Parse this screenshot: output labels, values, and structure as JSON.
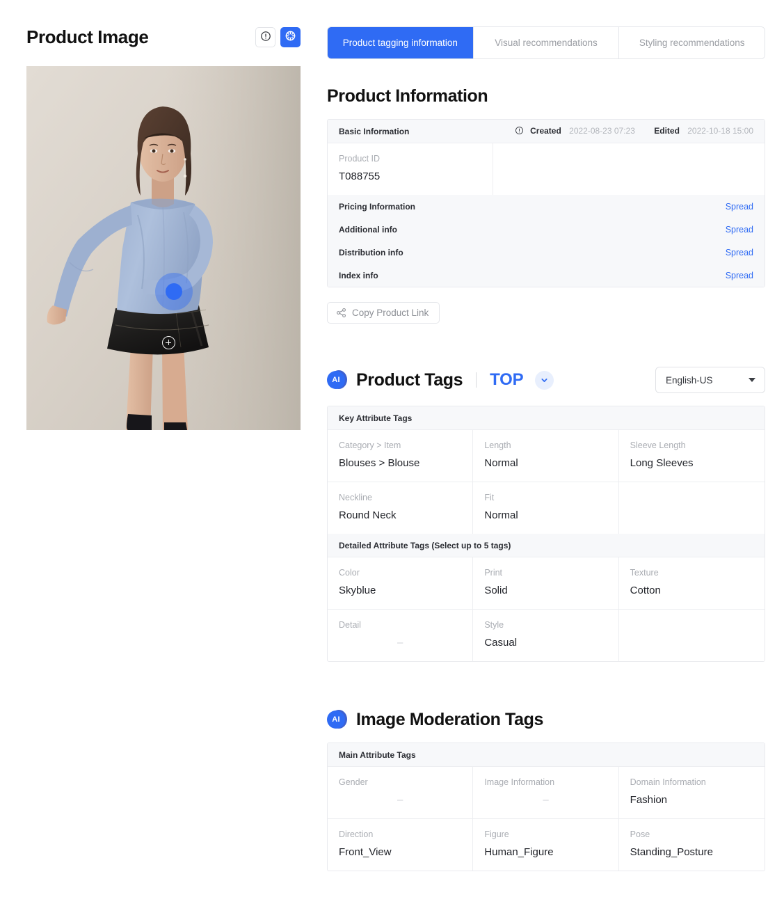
{
  "left": {
    "title": "Product Image",
    "actions": [
      {
        "name": "alert-info-button",
        "icon": "exclamation-circle-icon"
      },
      {
        "name": "tag-point-button",
        "icon": "crosshair-circle-icon"
      }
    ],
    "image_alt": "Female model wearing a sky blue blouse and black leather skirt",
    "hotspot_label": "tag-hotspot",
    "add_point_label": "add-tag-point"
  },
  "tabs": [
    {
      "label": "Product tagging information",
      "active": true
    },
    {
      "label": "Visual recommendations",
      "active": false
    },
    {
      "label": "Styling recommendations",
      "active": false
    }
  ],
  "product_information": {
    "heading": "Product Information",
    "basic": {
      "band_label": "Basic Information",
      "created_label": "Created",
      "created_value": "2022-08-23 07:23",
      "edited_label": "Edited",
      "edited_value": "2022-10-18 15:00",
      "field_label": "Product ID",
      "field_value": "T088755"
    },
    "collapsed_sections": [
      {
        "label": "Pricing Information",
        "action": "Spread"
      },
      {
        "label": "Additional info",
        "action": "Spread"
      },
      {
        "label": "Distribution info",
        "action": "Spread"
      },
      {
        "label": "Index info",
        "action": "Spread"
      }
    ],
    "copy_link_label": "Copy Product Link"
  },
  "product_tags": {
    "ai_badge": "AI",
    "heading": "Product Tags",
    "top_label": "TOP",
    "language": "English-US",
    "key_attributes": {
      "band_label": "Key Attribute Tags",
      "cells": [
        {
          "label": "Category > Item",
          "value": "Blouses > Blouse"
        },
        {
          "label": "Length",
          "value": "Normal"
        },
        {
          "label": "Sleeve Length",
          "value": "Long Sleeves"
        },
        {
          "label": "Neckline",
          "value": "Round Neck"
        },
        {
          "label": "Fit",
          "value": "Normal"
        },
        {
          "label": "",
          "value": ""
        }
      ]
    },
    "detailed_attributes": {
      "band_label": "Detailed Attribute Tags (Select up to 5 tags)",
      "cells": [
        {
          "label": "Color",
          "value": "Skyblue"
        },
        {
          "label": "Print",
          "value": "Solid"
        },
        {
          "label": "Texture",
          "value": "Cotton"
        },
        {
          "label": "Detail",
          "value": "–"
        },
        {
          "label": "Style",
          "value": "Casual"
        },
        {
          "label": "",
          "value": ""
        }
      ]
    }
  },
  "image_moderation": {
    "ai_badge": "AI",
    "heading": "Image Moderation Tags",
    "main_attributes": {
      "band_label": "Main Attribute Tags",
      "cells": [
        {
          "label": "Gender",
          "value": "–"
        },
        {
          "label": "Image Information",
          "value": "–"
        },
        {
          "label": "Domain Information",
          "value": "Fashion"
        },
        {
          "label": "Direction",
          "value": "Front_View"
        },
        {
          "label": "Figure",
          "value": "Human_Figure"
        },
        {
          "label": "Pose",
          "value": "Standing_Posture"
        }
      ]
    }
  },
  "colors": {
    "accent": "#2f6bf4",
    "band_bg": "#f7f8fa",
    "border": "#e9eaee",
    "muted_text": "#a9acb2"
  }
}
